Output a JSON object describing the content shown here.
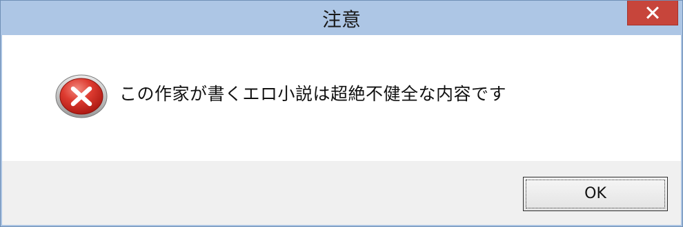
{
  "dialog": {
    "title": "注意",
    "message": "この作家が書くエロ小説は超絶不健全な内容です",
    "icon": "error-icon",
    "ok_label": "OK",
    "close_icon": "close-icon"
  },
  "colors": {
    "titlebar": "#adc6e5",
    "close_button": "#c7453b",
    "content_bg": "#ffffff",
    "footer_bg": "#f0f0f0",
    "error_red": "#d9332b"
  }
}
